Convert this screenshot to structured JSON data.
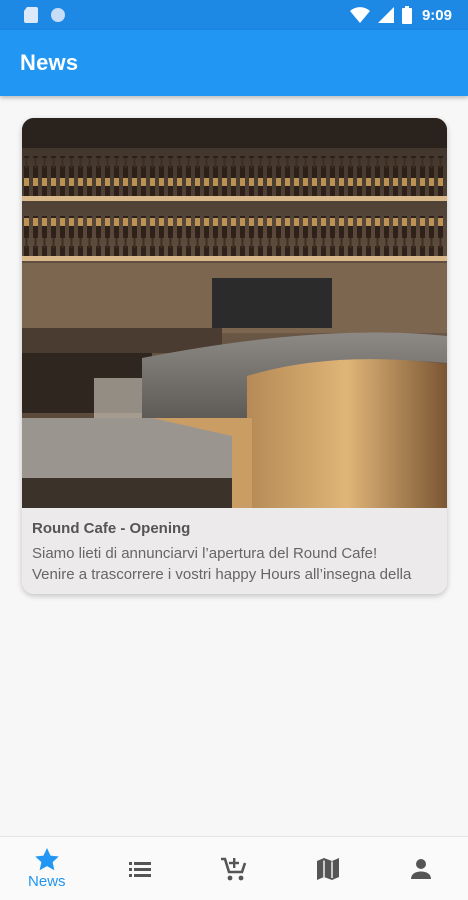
{
  "status_bar": {
    "time": "9:09",
    "icons": [
      "sd-card-icon",
      "circle-icon",
      "wifi-icon",
      "signal-icon",
      "battery-icon"
    ]
  },
  "app_bar": {
    "title": "News"
  },
  "news": [
    {
      "image": "bar-counter-photo",
      "title": "Round Cafe - Opening",
      "text_line1": "Siamo lieti di annunciarvi l’apertura del Round Cafe!",
      "text_line2": "Venire a trascorrere i vostri happy Hours all’insegna della"
    }
  ],
  "bottom_nav": {
    "items": [
      {
        "icon": "star-icon",
        "label": "News",
        "active": true
      },
      {
        "icon": "list-icon",
        "label": "",
        "active": false
      },
      {
        "icon": "add-cart-icon",
        "label": "",
        "active": false
      },
      {
        "icon": "map-icon",
        "label": "",
        "active": false
      },
      {
        "icon": "person-icon",
        "label": "",
        "active": false
      }
    ]
  },
  "colors": {
    "primary": "#2196f3",
    "status_bar": "#1e88e5",
    "background": "#f7f7f7"
  }
}
